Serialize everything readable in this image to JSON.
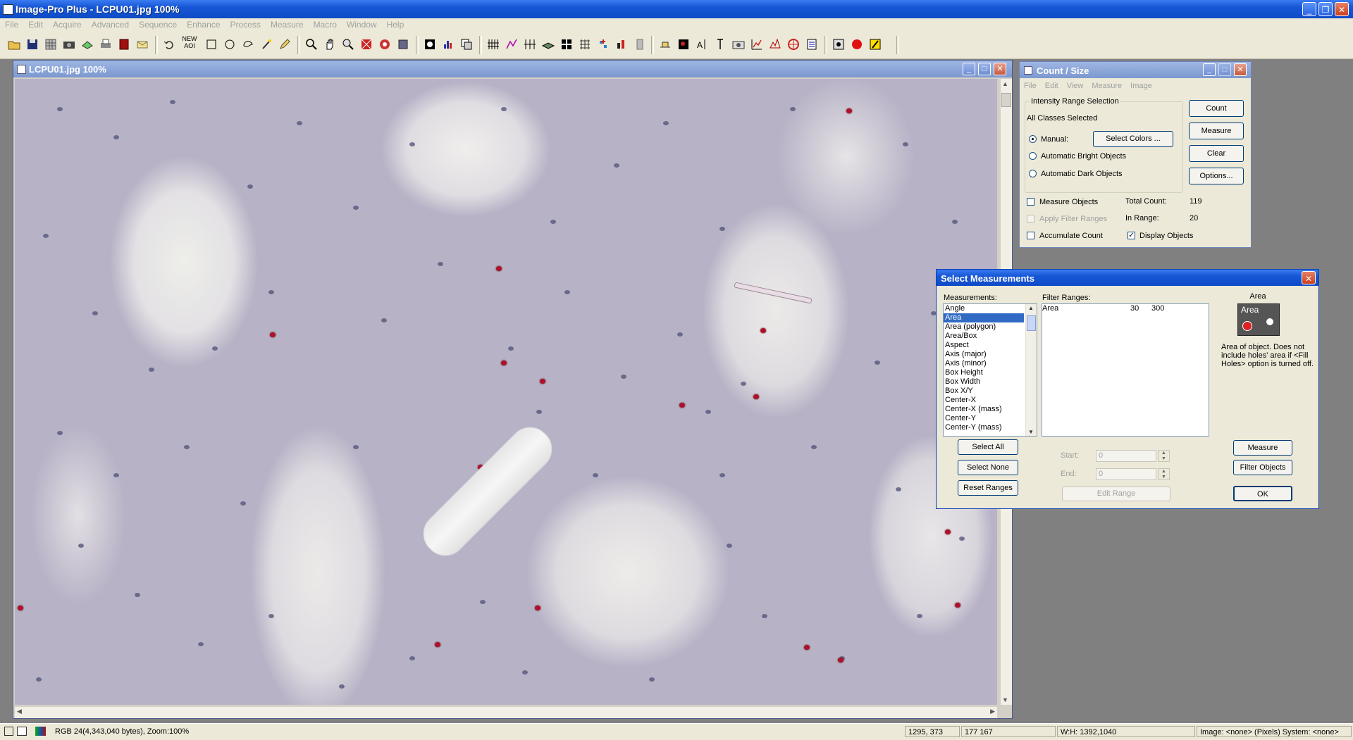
{
  "app": {
    "title": "Image-Pro Plus - LCPU01.jpg 100%"
  },
  "menubar": [
    "File",
    "Edit",
    "Acquire",
    "Advanced",
    "Sequence",
    "Enhance",
    "Process",
    "Measure",
    "Macro",
    "Window",
    "Help"
  ],
  "toolbar": {
    "new_aoi_label_1": "NEW",
    "new_aoi_label_2": "AOI"
  },
  "image_window": {
    "title": "LCPU01.jpg 100%"
  },
  "count_size": {
    "title": "Count / Size",
    "menu": [
      "File",
      "Edit",
      "View",
      "Measure",
      "Image"
    ],
    "intensity_group": "Intensity Range Selection",
    "all_classes": "All Classes Selected",
    "manual": "Manual:",
    "select_colors": "Select Colors ...",
    "auto_bright": "Automatic Bright Objects",
    "auto_dark": "Automatic Dark Objects",
    "buttons": {
      "count": "Count",
      "measure": "Measure",
      "clear": "Clear",
      "options": "Options..."
    },
    "measure_objects": "Measure Objects",
    "apply_filter": "Apply Filter Ranges",
    "accumulate": "Accumulate Count",
    "display_objects": "Display Objects",
    "total_count_label": "Total Count:",
    "total_count": "119",
    "in_range_label": "In Range:",
    "in_range": "20"
  },
  "select_measurements": {
    "title": "Select Measurements",
    "measurements_label": "Measurements:",
    "measurements": [
      "Angle",
      "Area",
      "Area (polygon)",
      "Area/Box",
      "Aspect",
      "Axis (major)",
      "Axis (minor)",
      "Box Height",
      "Box Width",
      "Box X/Y",
      "Center-X",
      "Center-X (mass)",
      "Center-Y",
      "Center-Y (mass)"
    ],
    "selected_index": 1,
    "filter_ranges_label": "Filter Ranges:",
    "filter_ranges": [
      {
        "name": "Area",
        "min": "30",
        "max": "300"
      }
    ],
    "preview_title": "Area",
    "preview_label": "Area",
    "description": "Area of object. Does not include holes' area if <Fill Holes> option is turned off.",
    "select_all": "Select All",
    "select_none": "Select None",
    "reset_ranges": "Reset Ranges",
    "start_label": "Start:",
    "start_value": "0",
    "end_label": "End:",
    "end_value": "0",
    "edit_range": "Edit Range",
    "measure": "Measure",
    "filter_objects": "Filter Objects",
    "ok": "OK"
  },
  "statusbar": {
    "info": "RGB 24(4,343,040 bytes), Zoom:100%",
    "coords": "1295, 373",
    "color": "177 167",
    "size": "W:H: 1392,1040",
    "image": "Image: <none> (Pixels) System: <none>"
  }
}
